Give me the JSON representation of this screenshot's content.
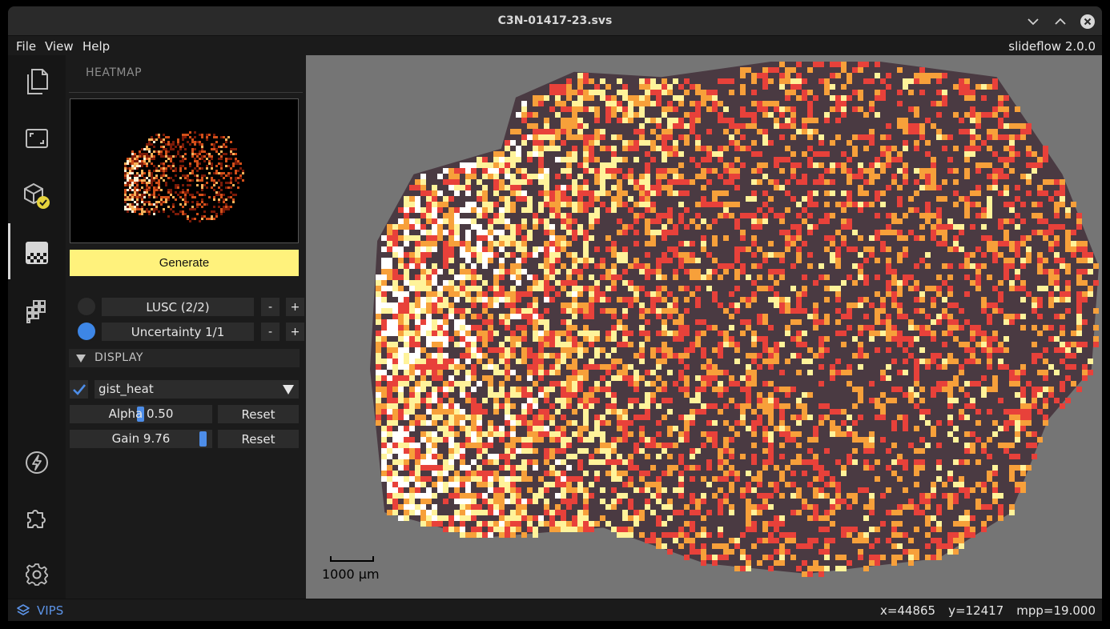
{
  "window": {
    "title": "C3N-01417-23.svs"
  },
  "menubar": {
    "file": "File",
    "view": "View",
    "help": "Help",
    "version": "slideflow 2.0.0"
  },
  "iconbar": {
    "items": [
      "files-icon",
      "slide-view-icon",
      "model-loaded-icon",
      "heatmap-icon",
      "grid-tiles-icon",
      "lightning-icon",
      "extensions-icon",
      "settings-icon"
    ],
    "active": "heatmap-icon"
  },
  "panel": {
    "header": "HEATMAP",
    "generate_label": "Generate",
    "outcome": {
      "label": "LUSC (2/2)",
      "minus": "-",
      "plus": "+",
      "dot_color": "#2c2c2c"
    },
    "uncertainty": {
      "label": "Uncertainty 1/1",
      "minus": "-",
      "plus": "+",
      "dot_color": "#3d86e6"
    },
    "display": {
      "section_label": "DISPLAY",
      "colormap_enabled": true,
      "colormap": "gist_heat",
      "alpha": {
        "label": "Alpha 0.50",
        "value": 0.5,
        "reset": "Reset"
      },
      "gain": {
        "label": "Gain 9.76",
        "value": 9.76,
        "reset": "Reset"
      }
    }
  },
  "viewer": {
    "scalebar_label": "1000 µm"
  },
  "statusbar": {
    "backend": "VIPS",
    "x": "x=44865",
    "y": "y=12417",
    "mpp": "mpp=19.000"
  },
  "colors": {
    "accent": "#4d8de8",
    "generate_button": "#fff27c",
    "heat_dark": "#4a3a42",
    "heat_red": "#e8413a",
    "heat_orange": "#f7a03a",
    "heat_yellow": "#fff39a"
  }
}
